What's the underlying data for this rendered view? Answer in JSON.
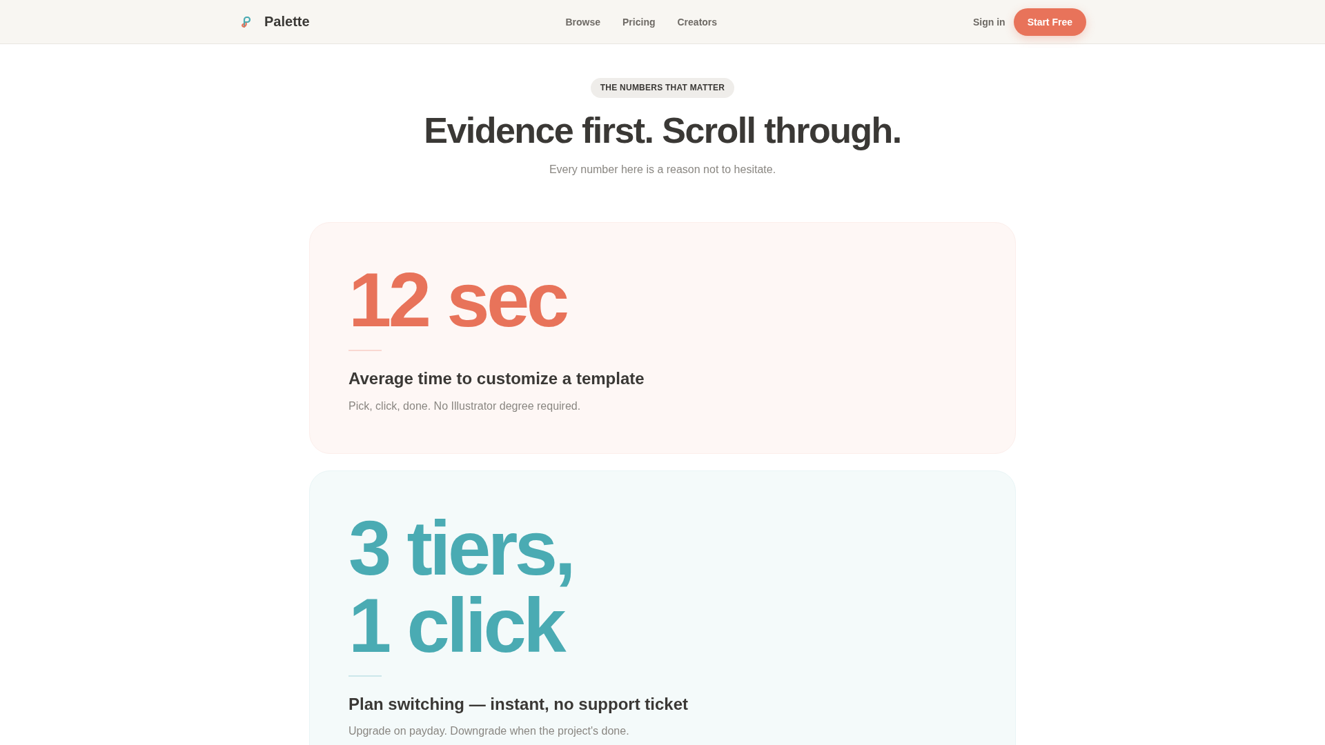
{
  "header": {
    "brand": "Palette",
    "nav": [
      {
        "label": "Browse"
      },
      {
        "label": "Pricing"
      },
      {
        "label": "Creators"
      }
    ],
    "sign_in": "Sign in",
    "cta": "Start Free"
  },
  "intro": {
    "eyebrow": "THE NUMBERS THAT MATTER",
    "title": "Evidence first. Scroll through.",
    "subtitle": "Every number here is a reason not to hesitate."
  },
  "stats": [
    {
      "value": "12 sec",
      "heading": "Average time to customize a template",
      "description": "Pick, click, done. No Illustrator degree required.",
      "color": "#e8735a"
    },
    {
      "value": "3 tiers, 1 click",
      "heading": "Plan switching — instant, no support ticket",
      "description": "Upgrade on payday. Downgrade when the project's done.",
      "color": "#4aabb3"
    }
  ]
}
